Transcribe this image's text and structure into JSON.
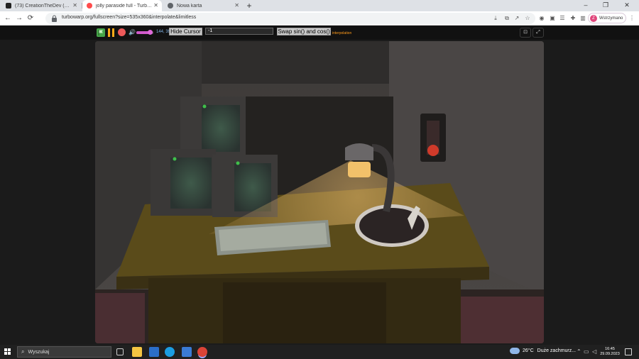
{
  "browser": {
    "tabs": [
      {
        "title": "(73) CreationTheDev (@MasterPl",
        "favicon_color": "#222222",
        "active": false
      },
      {
        "title": "jolly paraside full - TurboWarp",
        "favicon_color": "#ff4c4c",
        "active": true
      },
      {
        "title": "Nowa karta",
        "favicon_color": "#5f6368",
        "active": false
      }
    ],
    "new_tab": "+",
    "window_controls": {
      "minimize": "–",
      "restore": "❐",
      "close": "✕"
    },
    "nav": {
      "back": "←",
      "forward": "→",
      "reload": "⟳"
    },
    "url": "turbowarp.org/fullscreen?size=535x360&interpolate&limitless",
    "profile": {
      "initial": "Z",
      "label": "Wstrzymano"
    }
  },
  "turbowarp": {
    "coords": "144, 39",
    "volume_percent": 80,
    "hide_cursor_label": "Hide Cursor",
    "input_value": "-1",
    "swap_label": "Swap sin() and cos()",
    "interpolation_label": "interpolation",
    "colors": {
      "flag": "#47a54a",
      "pause": "#ffab19",
      "stop": "#ec5959",
      "volume": "#d05acb"
    }
  },
  "taskbar": {
    "search_placeholder": "Wyszukaj",
    "weather_temp": "26°C",
    "weather_desc": "Duże zachmurz...",
    "time": "16:45",
    "date": "29.09.2023"
  }
}
